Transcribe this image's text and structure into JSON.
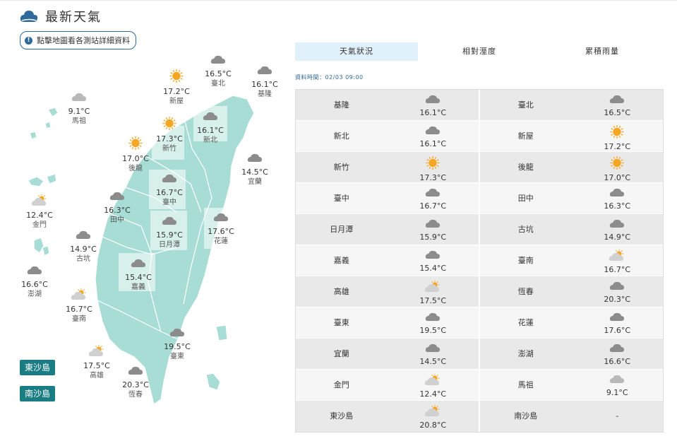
{
  "header": {
    "title": "最新天氣"
  },
  "detail_button": {
    "label": "點擊地圖看各測站詳細資料"
  },
  "islands": [
    {
      "label": "東沙島"
    },
    {
      "label": "南沙島"
    }
  ],
  "map_stations": [
    {
      "name": "臺北",
      "temp": "16.5°C",
      "icon": "cloudy"
    },
    {
      "name": "基隆",
      "temp": "16.1°C",
      "icon": "cloudy"
    },
    {
      "name": "新屋",
      "temp": "17.2°C",
      "icon": "sunny"
    },
    {
      "name": "馬祖",
      "temp": "9.1°C",
      "icon": "cloudy-light"
    },
    {
      "name": "新竹",
      "temp": "17.3°C",
      "icon": "sunny"
    },
    {
      "name": "新北",
      "temp": "16.1°C",
      "icon": "cloudy"
    },
    {
      "name": "後龍",
      "temp": "17.0°C",
      "icon": "sunny"
    },
    {
      "name": "宜蘭",
      "temp": "14.5°C",
      "icon": "cloudy"
    },
    {
      "name": "臺中",
      "temp": "16.7°C",
      "icon": "cloudy"
    },
    {
      "name": "田中",
      "temp": "16.3°C",
      "icon": "cloudy"
    },
    {
      "name": "金門",
      "temp": "12.4°C",
      "icon": "partly-cloudy"
    },
    {
      "name": "日月潭",
      "temp": "15.9°C",
      "icon": "cloudy"
    },
    {
      "name": "花蓮",
      "temp": "17.6°C",
      "icon": "cloudy"
    },
    {
      "name": "古坑",
      "temp": "14.9°C",
      "icon": "cloudy"
    },
    {
      "name": "澎湖",
      "temp": "16.6°C",
      "icon": "cloudy"
    },
    {
      "name": "嘉義",
      "temp": "15.4°C",
      "icon": "cloudy"
    },
    {
      "name": "臺南",
      "temp": "16.7°C",
      "icon": "partly-cloudy"
    },
    {
      "name": "臺東",
      "temp": "19.5°C",
      "icon": "cloudy"
    },
    {
      "name": "高雄",
      "temp": "17.5°C",
      "icon": "partly-cloudy"
    },
    {
      "name": "恆春",
      "temp": "20.3°C",
      "icon": "cloudy"
    }
  ],
  "tabs": [
    {
      "label": "天氣狀況",
      "active": true
    },
    {
      "label": "相對溼度",
      "active": false
    },
    {
      "label": "累積雨量",
      "active": false
    }
  ],
  "data_time": "資料時間：02/03 09:00",
  "table": [
    [
      {
        "name": "基隆",
        "temp": "16.1°C",
        "icon": "cloudy"
      },
      {
        "name": "臺北",
        "temp": "16.5°C",
        "icon": "cloudy"
      }
    ],
    [
      {
        "name": "新北",
        "temp": "16.1°C",
        "icon": "cloudy"
      },
      {
        "name": "新屋",
        "temp": "17.2°C",
        "icon": "sunny"
      }
    ],
    [
      {
        "name": "新竹",
        "temp": "17.3°C",
        "icon": "sunny"
      },
      {
        "name": "後龍",
        "temp": "17.0°C",
        "icon": "sunny"
      }
    ],
    [
      {
        "name": "臺中",
        "temp": "16.7°C",
        "icon": "cloudy"
      },
      {
        "name": "田中",
        "temp": "16.3°C",
        "icon": "cloudy"
      }
    ],
    [
      {
        "name": "日月潭",
        "temp": "15.9°C",
        "icon": "cloudy"
      },
      {
        "name": "古坑",
        "temp": "14.9°C",
        "icon": "cloudy"
      }
    ],
    [
      {
        "name": "嘉義",
        "temp": "15.4°C",
        "icon": "cloudy"
      },
      {
        "name": "臺南",
        "temp": "16.7°C",
        "icon": "partly-cloudy"
      }
    ],
    [
      {
        "name": "高雄",
        "temp": "17.5°C",
        "icon": "partly-cloudy"
      },
      {
        "name": "恆春",
        "temp": "20.3°C",
        "icon": "cloudy"
      }
    ],
    [
      {
        "name": "臺東",
        "temp": "19.5°C",
        "icon": "cloudy"
      },
      {
        "name": "花蓮",
        "temp": "17.6°C",
        "icon": "cloudy"
      }
    ],
    [
      {
        "name": "宜蘭",
        "temp": "14.5°C",
        "icon": "cloudy"
      },
      {
        "name": "澎湖",
        "temp": "16.6°C",
        "icon": "cloudy"
      }
    ],
    [
      {
        "name": "金門",
        "temp": "12.4°C",
        "icon": "partly-cloudy"
      },
      {
        "name": "馬祖",
        "temp": "9.1°C",
        "icon": "cloudy-light"
      }
    ],
    [
      {
        "name": "東沙島",
        "temp": "20.8°C",
        "icon": "partly-cloudy"
      },
      {
        "name": "南沙島",
        "temp": "-",
        "icon": ""
      }
    ]
  ],
  "colors": {
    "map_land": "#a8ddd6",
    "map_border": "#ffffff",
    "island_button": "#1a7d84",
    "accent": "#2f6a9b",
    "tab_active": "#e1f1fb",
    "sun": "#f5a623",
    "cloud": "#8c8c8c"
  }
}
